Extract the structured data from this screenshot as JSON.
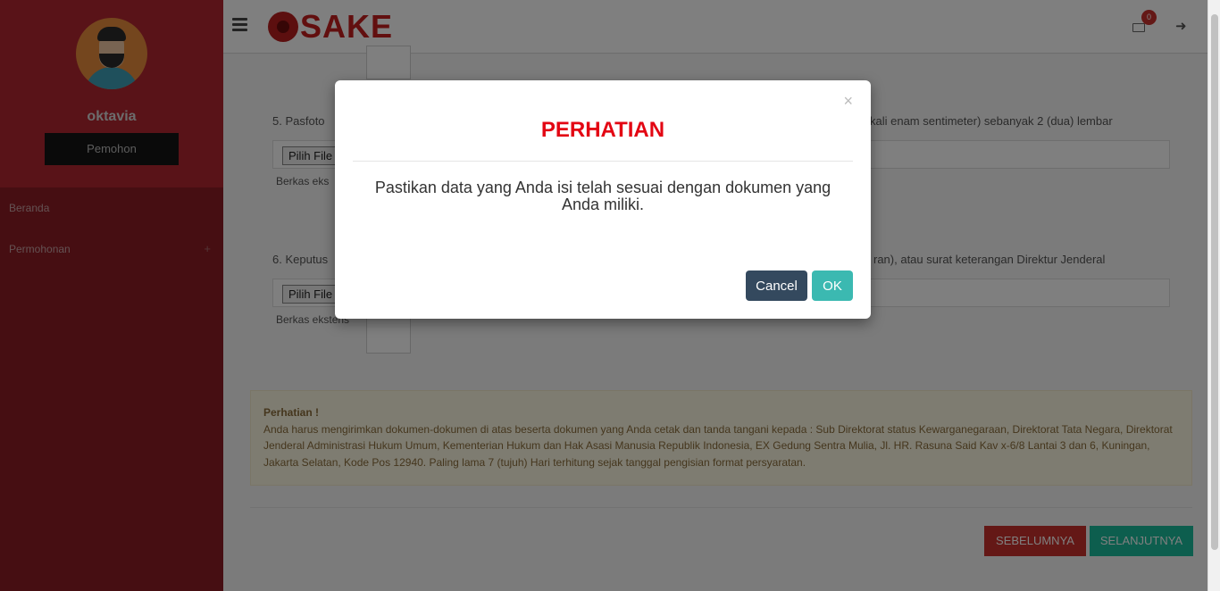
{
  "sidebar": {
    "user_name": "oktavia",
    "role_button": "Pemohon",
    "menu": [
      {
        "label": "Beranda"
      },
      {
        "label": "Permohonan",
        "expand": "+"
      }
    ]
  },
  "header": {
    "logo_text": "SAKE",
    "notification_count": "0",
    "icons": [
      "menu-icon",
      "mail-icon",
      "logout-icon"
    ]
  },
  "content": {
    "item5": {
      "label": "5.  Pasfoto",
      "tail": "kali enam sentimeter) sebanyak 2 (dua) lembar",
      "file_button": "Pilih File",
      "ext_text": "Berkas eks"
    },
    "item6": {
      "label": "6.  Keputus",
      "tail": "ran), atau surat keterangan Direktur Jenderal",
      "file_button": "Pilih File",
      "ext_text": "Berkas ekstens"
    },
    "alert": {
      "title": "Perhatian !",
      "text": "Anda harus mengirimkan dokumen-dokumen di atas beserta dokumen yang Anda cetak dan tanda tangani kepada : Sub Direktorat status Kewarganegaraan, Direktorat Tata Negara, Direktorat Jenderal Administrasi Hukum Umum, Kementerian Hukum dan Hak Asasi Manusia Republik Indonesia, EX Gedung Sentra Mulia, Jl. HR. Rasuna Said Kav x-6/8 Lantai 3 dan 6, Kuningan, Jakarta Selatan, Kode Pos 12940. Paling lama 7 (tujuh) Hari terhitung sejak tanggal pengisian format persyaratan."
    },
    "prev_button": "SEBELUMNYA",
    "next_button": "SELANJUTNYA"
  },
  "modal": {
    "close": "×",
    "title": "PERHATIAN",
    "message": "Pastikan data yang Anda isi telah sesuai dengan dokumen yang Anda miliki.",
    "cancel_label": "Cancel",
    "ok_label": "OK"
  },
  "colors": {
    "sidebar": "#8c1c24",
    "sidebar_profile": "#b22631",
    "title_red": "#e30613",
    "ok_button": "#3bb9b1",
    "cancel_button": "#34495e",
    "prev_button": "#c9302c",
    "next_button": "#1abc9c"
  }
}
